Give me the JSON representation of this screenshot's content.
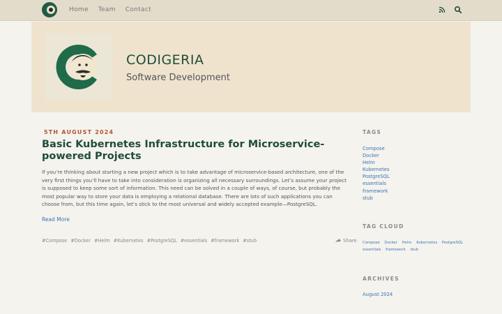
{
  "nav": {
    "links": [
      "Home",
      "Team",
      "Contact"
    ],
    "icons": [
      "rss-icon",
      "search-icon"
    ]
  },
  "hero": {
    "title": "CODIGERIA",
    "subtitle": "Software Development"
  },
  "post": {
    "date": "5th August 2024",
    "title": "Basic Kubernetes Infrastructure for Microservice-powered Projects",
    "excerpt": "If you’re thinking about starting a new project which is to take advantage of microservice-based architecture, one of the very first things you’ll have to take into consideration is organizing all necessary surroundings. Let’s assume your project is supposed to keep some sort of information. This need can be solved in a couple of ways, of course, but probably the most popular way to store your data is employing a relational database. There are lots of such applications you can choose from, but this time again, let’s stick to the most universal and widely accepted example—PostgreSQL.",
    "read_more": "Read More",
    "tags": [
      "#Compose",
      "#Docker",
      "#Helm",
      "#Kubernetes",
      "#PostgreSQL",
      "#essentials",
      "#framework",
      "#stub"
    ],
    "share": "Share"
  },
  "sidebar": {
    "tags_heading": "Tags",
    "tags": [
      "Compose",
      "Docker",
      "Helm",
      "Kubernetes",
      "PostgreSQL",
      "essentials",
      "framework",
      "stub"
    ],
    "cloud_heading": "Tag Cloud",
    "cloud": [
      "Compose",
      "Docker",
      "Helm",
      "Kubernetes",
      "PostgreSQL",
      "essentials",
      "framework",
      "stub"
    ],
    "archives_heading": "Archives",
    "archives": [
      "August 2024"
    ]
  },
  "colors": {
    "accent": "#1f4d3a",
    "link": "#3a74b0",
    "date": "#b05533",
    "nav_bg": "#e4dccb",
    "hero_bg": "#efe3ce"
  }
}
